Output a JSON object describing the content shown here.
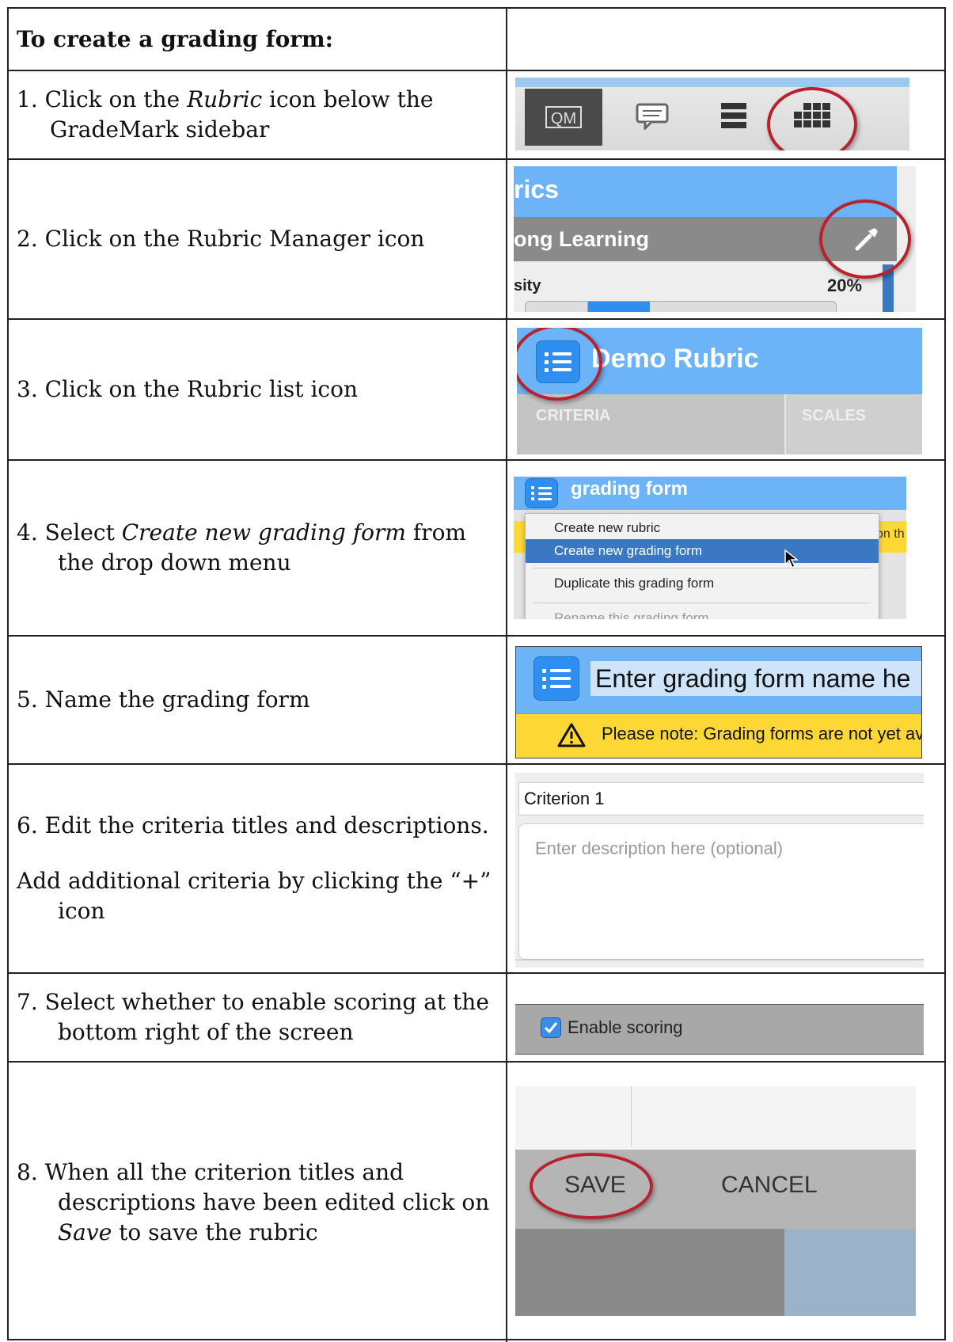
{
  "header": {
    "title": "To create a grading form:"
  },
  "steps": [
    {
      "num": "1.",
      "pre": "Click on the ",
      "em": "Rubric",
      "post": " icon below the GradeMark sidebar"
    },
    {
      "num": "2.",
      "text": "Click on the Rubric Manager icon"
    },
    {
      "num": "3.",
      "text": "Click on the Rubric list icon"
    },
    {
      "num": "4.",
      "pre": "Select ",
      "em": "Create new grading form",
      "post": " from the drop down menu"
    },
    {
      "num": "5.",
      "text": "Name the grading form"
    },
    {
      "num": "6.",
      "text": "Edit the criteria titles and descriptions.",
      "extra": "Add additional criteria by clicking the “+” icon"
    },
    {
      "num": "7.",
      "text": "Select whether to enable scoring at the bottom right of the screen"
    },
    {
      "num": "8.",
      "pre": "When all the criterion titles and descriptions have been edited click on ",
      "em": "Save",
      "post": " to save the rubric"
    }
  ],
  "shots": {
    "s1": {
      "qm": "QM"
    },
    "s2": {
      "title": "rics",
      "course": "ong Learning",
      "label": "sity",
      "pct": "20%"
    },
    "s3": {
      "title": "Demo Rubric",
      "col1": "CRITERIA",
      "col2": "SCALES"
    },
    "s4": {
      "title": "grading form",
      "items": [
        "Create new rubric",
        "Create new grading form",
        "Duplicate this grading form",
        "Rename this grading form"
      ],
      "edge": "on th"
    },
    "s5": {
      "name": "Enter grading form name he",
      "note": "Please note: Grading forms are not yet av"
    },
    "s6": {
      "criterion": "Criterion 1",
      "placeholder": "Enter description here (optional)"
    },
    "s7": {
      "label": "Enable scoring"
    },
    "s8": {
      "save": "SAVE",
      "cancel": "CANCEL"
    }
  },
  "colors": {
    "ring": "#b8222e",
    "header_blue": "#6cb4f7",
    "list_btn": "#2f8ff0",
    "note_yellow": "#fdd835"
  }
}
